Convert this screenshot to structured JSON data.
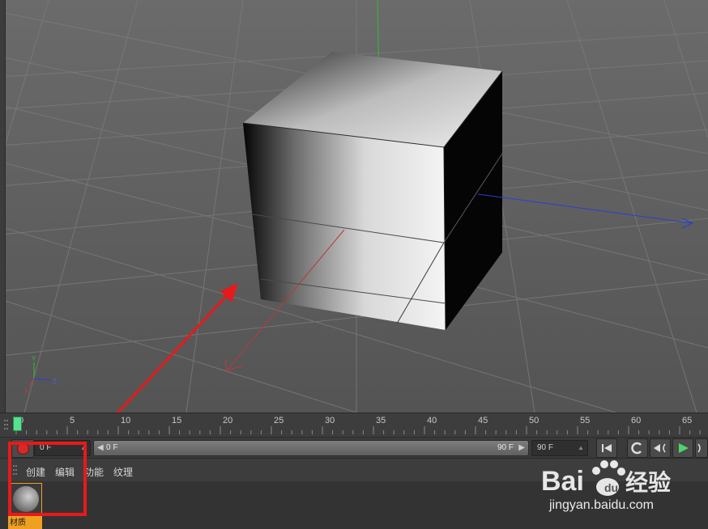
{
  "viewport": {
    "axis_labels": {
      "y": "Y",
      "z": "Z",
      "x": "X"
    }
  },
  "timeline": {
    "ticks": [
      "0",
      "5",
      "10",
      "15",
      "20",
      "25",
      "30",
      "35",
      "40",
      "45",
      "50",
      "55",
      "60",
      "65"
    ],
    "current_frame": 0
  },
  "transport": {
    "current_frame_field": "0 F",
    "range_start": "0 F",
    "range_end": "90 F",
    "end_frame_field": "90 F"
  },
  "material_manager": {
    "menu": [
      "创建",
      "编辑",
      "功能",
      "纹理"
    ],
    "materials": [
      {
        "label": "材质"
      }
    ]
  },
  "watermark": {
    "logo_text": "Bai",
    "logo_text2": "经验",
    "url": "jingyan.baidu.com"
  },
  "colors": {
    "highlight": "#e8191b",
    "material_selected": "#f0a020",
    "playhead": "#56e090"
  }
}
